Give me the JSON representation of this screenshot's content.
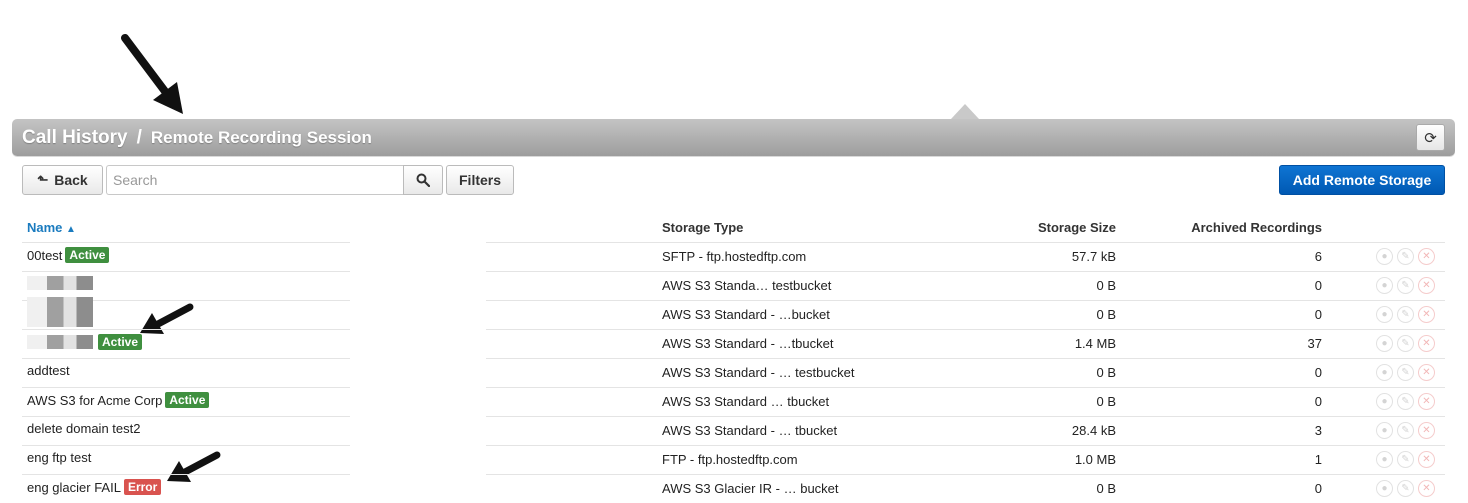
{
  "breadcrumb": {
    "main": "Call History",
    "separator": "/",
    "sub": "Remote Recording Session"
  },
  "toolbar": {
    "back_label": "Back",
    "search_placeholder": "Search",
    "filters_label": "Filters",
    "add_label": "Add Remote Storage"
  },
  "table": {
    "headers": {
      "name": "Name",
      "storage_type": "Storage Type",
      "storage_size": "Storage Size",
      "archived": "Archived Recordings"
    },
    "sort": {
      "column": "name",
      "direction": "ascending"
    },
    "rows": [
      {
        "name": "00test",
        "badge": "Active",
        "type": "SFTP - ftp.hostedftp.com",
        "size": "57.7 kB",
        "archived": "6"
      },
      {
        "name": "",
        "badge": "",
        "type": "AWS S3 Standa… testbucket",
        "size": "0 B",
        "archived": "0"
      },
      {
        "name": "",
        "badge": "",
        "type": "AWS S3 Standard - …bucket",
        "size": "0 B",
        "archived": "0"
      },
      {
        "name": "",
        "badge": "Active",
        "type": "AWS S3 Standard - …tbucket",
        "size": "1.4 MB",
        "archived": "37"
      },
      {
        "name": "addtest",
        "badge": "",
        "type": "AWS S3 Standard - … testbucket",
        "size": "0 B",
        "archived": "0"
      },
      {
        "name": "AWS S3 for Acme Corp",
        "badge": "Active",
        "type": "AWS S3 Standard … tbucket",
        "size": "0 B",
        "archived": "0"
      },
      {
        "name": "delete domain test2",
        "badge": "",
        "type": "AWS S3 Standard - … tbucket",
        "size": "28.4 kB",
        "archived": "3"
      },
      {
        "name": "eng ftp test",
        "badge": "",
        "type": "FTP - ftp.hostedftp.com",
        "size": "1.0 MB",
        "archived": "1"
      },
      {
        "name": "eng glacier FAIL",
        "badge": "Error",
        "type": "AWS S3 Glacier IR - … bucket",
        "size": "0 B",
        "archived": "0"
      }
    ]
  },
  "icons": {
    "back": "arrow-back-icon",
    "search": "magnifier-icon",
    "refresh": "refresh-icon",
    "sort": "sort-up-caret-icon",
    "row_actions": [
      "view-icon",
      "edit-icon",
      "delete-icon"
    ]
  },
  "colors": {
    "primary_button": "#0f75d3",
    "active_badge": "#3f8f3f",
    "error_badge": "#d9534f",
    "header_link": "#1a7bbf"
  }
}
